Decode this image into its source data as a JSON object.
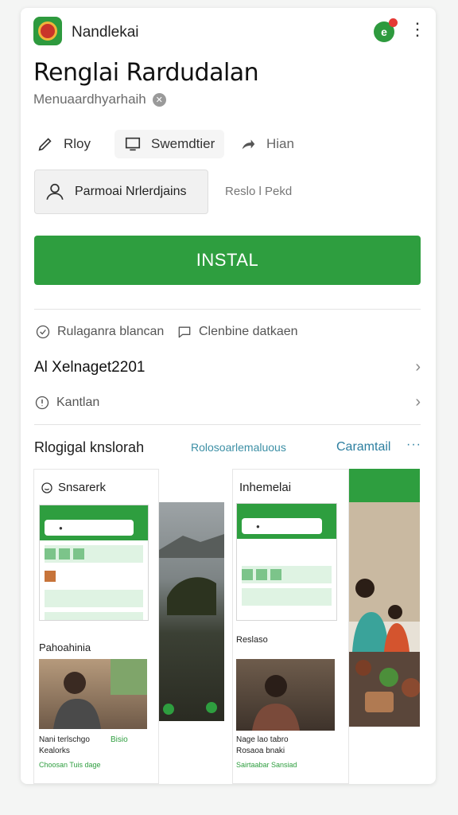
{
  "header": {
    "app_name": "Nandlekai",
    "title": "Renglai Rardudalan",
    "subtitle": "Menuaardhyarhaih"
  },
  "actions": {
    "a1": "Rloy",
    "a2": "Swemdtier",
    "a3": "Hian"
  },
  "person_button": "Parmoai Nrlerdjains",
  "side_link": "Reslo l Pekd",
  "install_label": "INSTAL",
  "meta": {
    "left": "Rulaganra blancan",
    "right": "Clenbine datkaen"
  },
  "rows": {
    "row1": "Al  Xelnaget2201",
    "row2": "Kantlan"
  },
  "section": {
    "title": "Rlogigal knslorah",
    "sub": "Rolosoarlemaluous",
    "link": "Caramtail",
    "more": "···"
  },
  "screens": {
    "s1_label": "Snsarerk",
    "s1_news": "Pahoahinia",
    "s1_cap1": "Nani terlschgo",
    "s1_cap1_tag": "Bisio",
    "s1_cap2": "Kealorks",
    "s1_cap3": "Choosan  Tuis dage",
    "s2_label": "Inhemelai",
    "s2_news": "Reslaso",
    "s2_cap1": "Nage lao tabro",
    "s2_cap2": "Rosaoa bnaki",
    "s2_cap3": "Sairtaabar  Sansiad"
  },
  "colors": {
    "accent_green": "#2e9e3f",
    "link_blue": "#2d7fa0"
  }
}
